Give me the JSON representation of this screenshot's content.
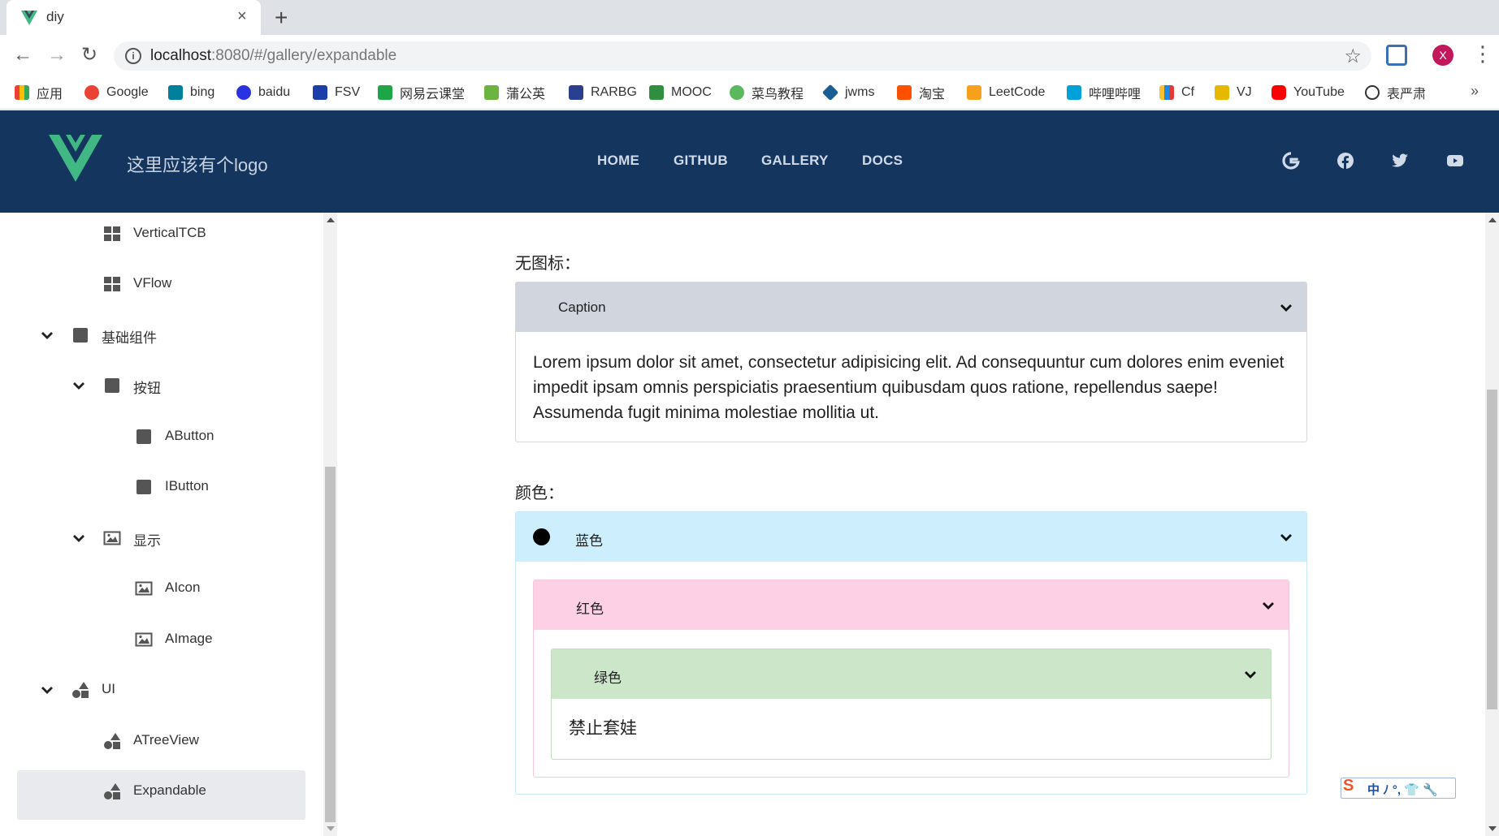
{
  "browser": {
    "tab_title": "diy",
    "tab_close": "×",
    "new_tab": "+",
    "url_host": "localhost",
    "url_rest": ":8080/#/gallery/expandable",
    "avatar_letter": "X",
    "more": "»",
    "bookmarks": [
      {
        "label": "应用",
        "color": "#4285f4"
      },
      {
        "label": "Google",
        "color": "#ea4335"
      },
      {
        "label": "bing",
        "color": "#00809d"
      },
      {
        "label": "baidu",
        "color": "#2932e1"
      },
      {
        "label": "FSV",
        "color": "#1a3fa8"
      },
      {
        "label": "网易云课堂",
        "color": "#1ea548"
      },
      {
        "label": "蒲公英",
        "color": "#6cb33f"
      },
      {
        "label": "RARBG",
        "color": "#2a3f8f"
      },
      {
        "label": "MOOC",
        "color": "#2f8f3e"
      },
      {
        "label": "菜鸟教程",
        "color": "#5cb85c"
      },
      {
        "label": "jwms",
        "color": "#1b5e94"
      },
      {
        "label": "淘宝",
        "color": "#ff5000"
      },
      {
        "label": "LeetCode",
        "color": "#f89f1b"
      },
      {
        "label": "哔哩哔哩",
        "color": "#00a1d6"
      },
      {
        "label": "Cf",
        "color": "#1e88e5"
      },
      {
        "label": "VJ",
        "color": "#e6b800"
      },
      {
        "label": "YouTube",
        "color": "#ff0000"
      },
      {
        "label": "表严肃",
        "color": "#333333"
      }
    ]
  },
  "app": {
    "logo_text": "这里应该有个logo",
    "nav": [
      "HOME",
      "GITHUB",
      "GALLERY",
      "DOCS"
    ],
    "social_icons": [
      "google-icon",
      "facebook-icon",
      "twitter-icon",
      "youtube-icon"
    ],
    "brand_color": "#14355e",
    "logo_green": "#41b883",
    "logo_dark": "#35495e"
  },
  "sidebar": {
    "items": [
      {
        "label": "VerticalTCB",
        "icon": "grid-icon",
        "chevron": false
      },
      {
        "label": "VFlow",
        "icon": "grid-icon",
        "chevron": false
      },
      {
        "label": "基础组件",
        "icon": "square-icon",
        "chevron": true
      },
      {
        "label": "按钮",
        "icon": "square-icon",
        "chevron": true
      },
      {
        "label": "AButton",
        "icon": "square-icon",
        "chevron": false
      },
      {
        "label": "IButton",
        "icon": "square-icon",
        "chevron": false
      },
      {
        "label": "显示",
        "icon": "image-icon",
        "chevron": true
      },
      {
        "label": "AIcon",
        "icon": "image-icon",
        "chevron": false
      },
      {
        "label": "AImage",
        "icon": "image-icon",
        "chevron": false
      },
      {
        "label": "UI",
        "icon": "shapes-icon",
        "chevron": true
      },
      {
        "label": "ATreeView",
        "icon": "shapes-icon",
        "chevron": false
      },
      {
        "label": "Expandable",
        "icon": "shapes-icon",
        "chevron": false,
        "selected": true
      }
    ]
  },
  "main": {
    "section1_label": "无图标：",
    "caption_title": "Caption",
    "caption_body": "Lorem ipsum dolor sit amet, consectetur adipisicing elit. Ad consequuntur cum dolores enim eveniet impedit ipsam omnis perspiciatis praesentium quibusdam quos ratione, repellendus saepe! Assumenda fugit minima molestiae mollitia ut.",
    "section2_label": "颜色：",
    "blue_title": "蓝色",
    "red_title": "红色",
    "green_title": "绿色",
    "green_body": "禁止套娃",
    "colors": {
      "caption_head": "#d0d5de",
      "blue_head": "#cdeffd",
      "blue_border": "#c6e8f7",
      "red_head": "#fdd0e6",
      "red_border": "#f5c7dc",
      "green_head": "#cbe6c8",
      "green_border": "#c3dcbf"
    }
  },
  "ime": {
    "logo": "S",
    "text": "中 ﾉ °, 👕 🔧"
  }
}
